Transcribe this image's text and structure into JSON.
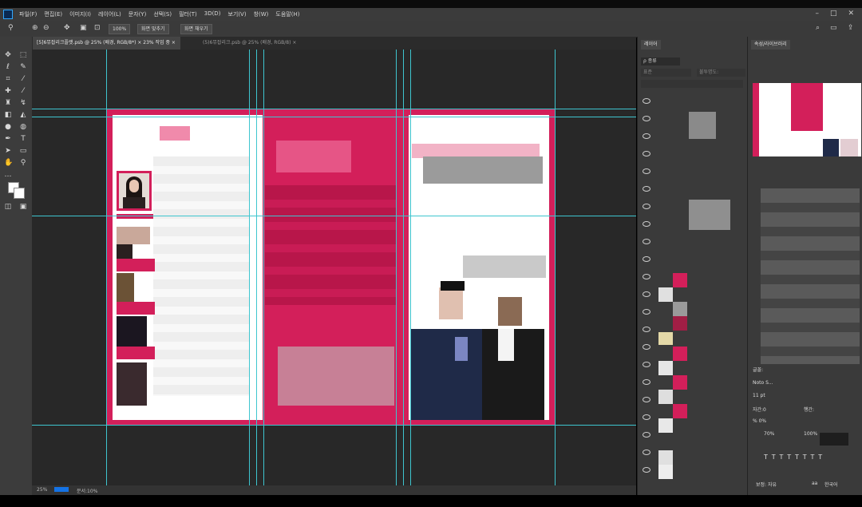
{
  "app": {
    "menus": [
      "파일(F)",
      "편집(E)",
      "이미지(I)",
      "레이어(L)",
      "문자(Y)",
      "선택(S)",
      "필터(T)",
      "3D(D)",
      "보기(V)",
      "창(W)",
      "도움말(H)"
    ],
    "window_controls": [
      "–",
      "□",
      "✕"
    ]
  },
  "options_bar": {
    "zoom_value": "100%",
    "fit_screen": "화면 맞추기",
    "fill_screen": "화면 채우기"
  },
  "tabs": [
    {
      "label": "[5]6뮤잡리크플랫.psb @ 25% (배경, RGB/8*) × 23% 작업 중 ×",
      "active": true
    },
    {
      "label": "(5)6뮤잡리크.psb @ 25% (배경, RGB/8) ×",
      "active": false
    }
  ],
  "status": {
    "zoom": "25%",
    "doc": "문서:10%"
  },
  "layers_panel": {
    "title": "레이어",
    "kind_label": "ρ 종류",
    "mode_label": "표준",
    "opacity_label": "불투명도:"
  },
  "properties_panel": {
    "title": "속성/라이브러리",
    "fields": [
      "글꼴:",
      "Noto S...",
      "11 pt",
      "자간:0",
      "% 0%",
      "70%",
      "보정: 자유"
    ],
    "values": [
      "행간:",
      "100%",
      "aa",
      "한국어"
    ]
  },
  "colors": {
    "brand_pink": "#d31f5a",
    "page_white": "#ffffff",
    "guide": "#3ec5cf",
    "ui_dark": "#3a3a3a"
  }
}
